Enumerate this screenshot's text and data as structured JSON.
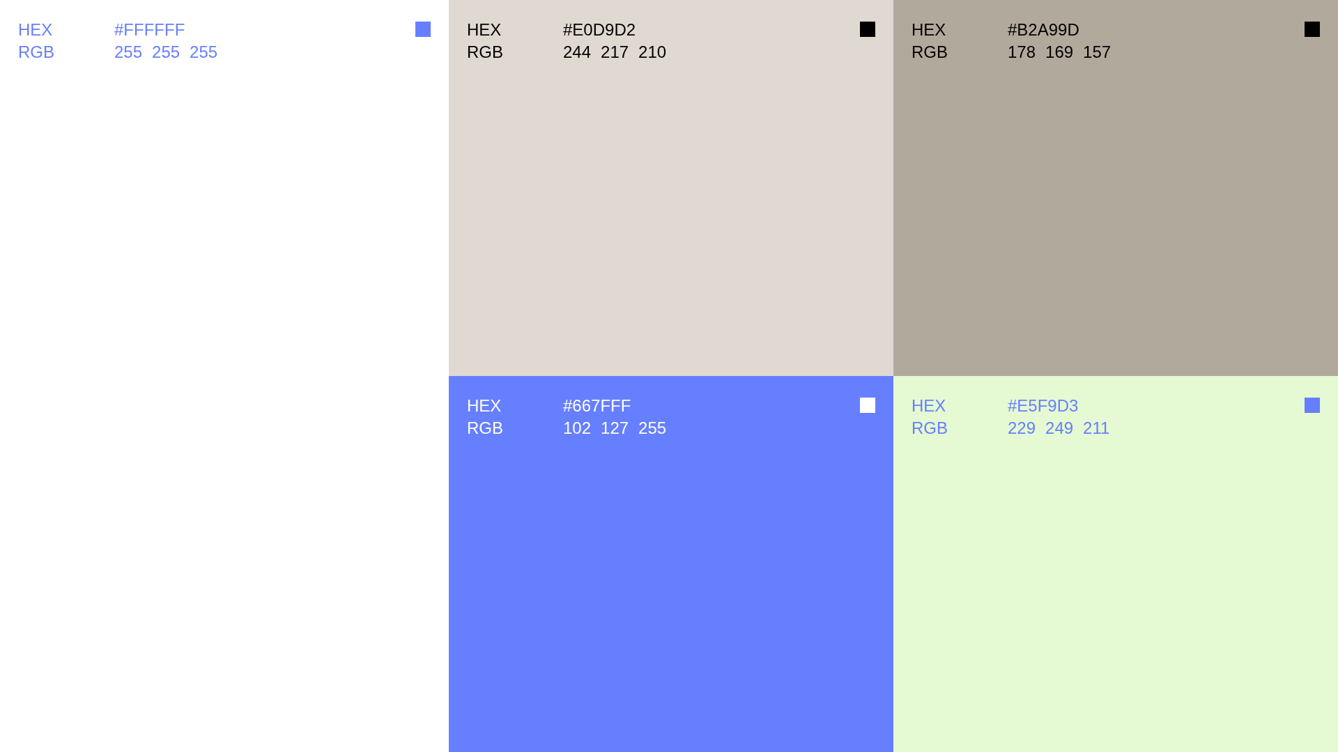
{
  "swatches": [
    {
      "color": "#ffffff",
      "kind": "accent",
      "hex_label": "HEX",
      "hex": "#FFFFFF",
      "rgb_label": "RGB",
      "rgb": [
        "255",
        "255",
        "255"
      ]
    },
    {
      "color": "#e0d9d2",
      "kind": "dark",
      "hex_label": "HEX",
      "hex": "#E0D9D2",
      "rgb_label": "RGB",
      "rgb": [
        "244",
        "217",
        "210"
      ]
    },
    {
      "color": "#b2a99d",
      "kind": "dark",
      "hex_label": "HEX",
      "hex": "#B2A99D",
      "rgb_label": "RGB",
      "rgb": [
        "178",
        "169",
        "157"
      ]
    },
    {
      "color": "#667fff",
      "kind": "light",
      "hex_label": "HEX",
      "hex": "#667FFF",
      "rgb_label": "RGB",
      "rgb": [
        "102",
        "127",
        "255"
      ]
    },
    {
      "color": "#e5f9d3",
      "kind": "accent",
      "hex_label": "HEX",
      "hex": "#E5F9D3",
      "rgb_label": "RGB",
      "rgb": [
        "229",
        "249",
        "211"
      ]
    }
  ]
}
